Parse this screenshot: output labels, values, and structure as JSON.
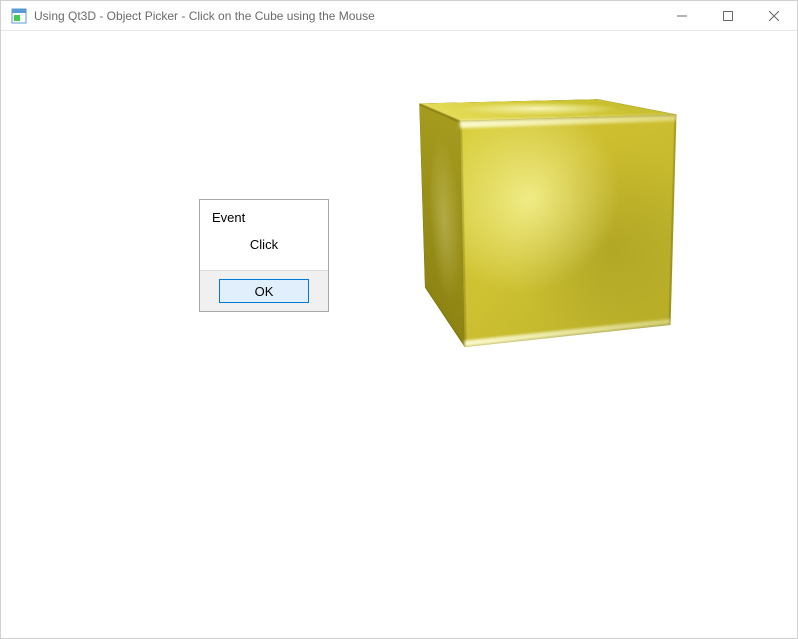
{
  "window": {
    "title": "Using Qt3D - Object Picker - Click on the Cube using the Mouse",
    "icon": "app-icon"
  },
  "scene": {
    "object_name": "gold-cube"
  },
  "dialog": {
    "title": "Event",
    "message": "Click",
    "ok_label": "OK"
  }
}
